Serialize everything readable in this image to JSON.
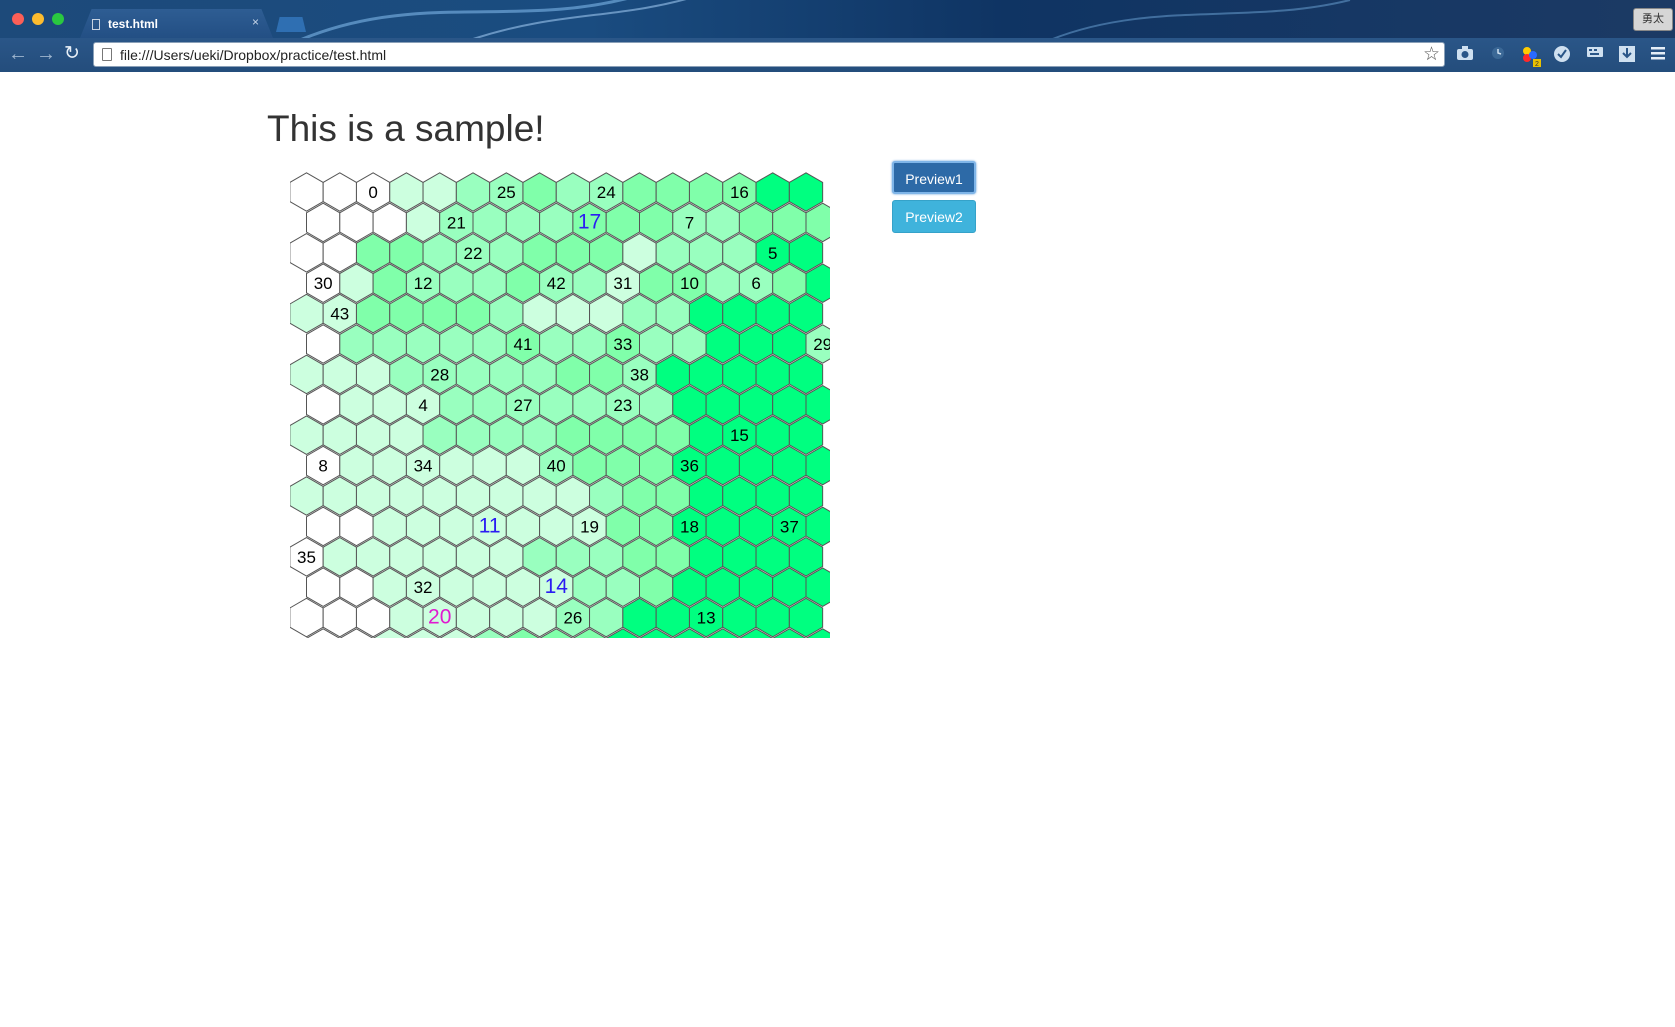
{
  "browser": {
    "tab_title": "test.html",
    "tab_close": "×",
    "url": "file:///Users/ueki/Dropbox/practice/test.html",
    "profile_label": "勇太",
    "toolbar_icons": [
      "back-icon",
      "forward-icon",
      "reload-icon",
      "bookmark-star-icon",
      "camera-icon",
      "clock-icon",
      "colors-icon",
      "check-icon",
      "keyboard-icon",
      "download-icon",
      "menu-icon"
    ],
    "colors_badge": "2"
  },
  "page": {
    "title": "This is a sample!",
    "buttons": {
      "preview1": "Preview1",
      "preview2": "Preview2"
    }
  },
  "hexmap": {
    "columns": 16,
    "rows": 16,
    "palette": [
      "#ffffff",
      "#ccffdf",
      "#99ffbf",
      "#80ffaa",
      "#00ff80"
    ],
    "levels": [
      "0001122322333344",
      "0001222233322333",
      "0033222333122244",
      "0132223221332234",
      "1133332111224444",
      "0222223223224442",
      "1112222233244444",
      "0111222222244444",
      "1111222233334444",
      "0111111233344444",
      "1111111112334444",
      "0011111113344444",
      "0111111222334444",
      "0011111122344444",
      "0001111122444444",
      "0011123334444444"
    ],
    "labels": [
      {
        "row": 0,
        "col": 2,
        "text": "0",
        "color": "#000000"
      },
      {
        "row": 0,
        "col": 6,
        "text": "25",
        "color": "#000000"
      },
      {
        "row": 0,
        "col": 9,
        "text": "24",
        "color": "#000000"
      },
      {
        "row": 0,
        "col": 13,
        "text": "16",
        "color": "#000000"
      },
      {
        "row": 1,
        "col": 4,
        "text": "21",
        "color": "#000000"
      },
      {
        "row": 1,
        "col": 8,
        "text": "17",
        "color": "#2b1cf2"
      },
      {
        "row": 1,
        "col": 11,
        "text": "7",
        "color": "#000000"
      },
      {
        "row": 2,
        "col": 5,
        "text": "22",
        "color": "#000000"
      },
      {
        "row": 2,
        "col": 14,
        "text": "5",
        "color": "#000000"
      },
      {
        "row": 3,
        "col": 0,
        "text": "30",
        "color": "#000000"
      },
      {
        "row": 3,
        "col": 3,
        "text": "12",
        "color": "#000000"
      },
      {
        "row": 3,
        "col": 7,
        "text": "42",
        "color": "#000000"
      },
      {
        "row": 3,
        "col": 9,
        "text": "31",
        "color": "#000000"
      },
      {
        "row": 3,
        "col": 11,
        "text": "10",
        "color": "#000000"
      },
      {
        "row": 3,
        "col": 13,
        "text": "6",
        "color": "#000000"
      },
      {
        "row": 4,
        "col": 1,
        "text": "43",
        "color": "#000000"
      },
      {
        "row": 5,
        "col": 6,
        "text": "41",
        "color": "#000000"
      },
      {
        "row": 5,
        "col": 9,
        "text": "33",
        "color": "#000000"
      },
      {
        "row": 5,
        "col": 15,
        "text": "29",
        "color": "#000000"
      },
      {
        "row": 6,
        "col": 4,
        "text": "28",
        "color": "#000000"
      },
      {
        "row": 6,
        "col": 10,
        "text": "38",
        "color": "#000000"
      },
      {
        "row": 7,
        "col": 3,
        "text": "4",
        "color": "#000000"
      },
      {
        "row": 7,
        "col": 6,
        "text": "27",
        "color": "#000000"
      },
      {
        "row": 7,
        "col": 9,
        "text": "23",
        "color": "#000000"
      },
      {
        "row": 8,
        "col": 13,
        "text": "15",
        "color": "#000000"
      },
      {
        "row": 9,
        "col": 0,
        "text": "8",
        "color": "#000000"
      },
      {
        "row": 9,
        "col": 3,
        "text": "34",
        "color": "#000000"
      },
      {
        "row": 9,
        "col": 7,
        "text": "40",
        "color": "#000000"
      },
      {
        "row": 9,
        "col": 11,
        "text": "36",
        "color": "#000000"
      },
      {
        "row": 10,
        "col": 0,
        "text": "",
        "color": "#000000"
      },
      {
        "row": 11,
        "col": 5,
        "text": "11",
        "color": "#2b1cf2"
      },
      {
        "row": 11,
        "col": 8,
        "text": "19",
        "color": "#000000"
      },
      {
        "row": 11,
        "col": 11,
        "text": "18",
        "color": "#000000"
      },
      {
        "row": 11,
        "col": 14,
        "text": "37",
        "color": "#000000"
      },
      {
        "row": 12,
        "col": 0,
        "text": "35",
        "color": "#000000"
      },
      {
        "row": 13,
        "col": 3,
        "text": "32",
        "color": "#000000"
      },
      {
        "row": 13,
        "col": 7,
        "text": "14",
        "color": "#2b1cf2"
      },
      {
        "row": 14,
        "col": 4,
        "text": "20",
        "color": "#e01bd0"
      },
      {
        "row": 14,
        "col": 8,
        "text": "26",
        "color": "#000000"
      },
      {
        "row": 14,
        "col": 12,
        "text": "13",
        "color": "#000000"
      }
    ]
  }
}
